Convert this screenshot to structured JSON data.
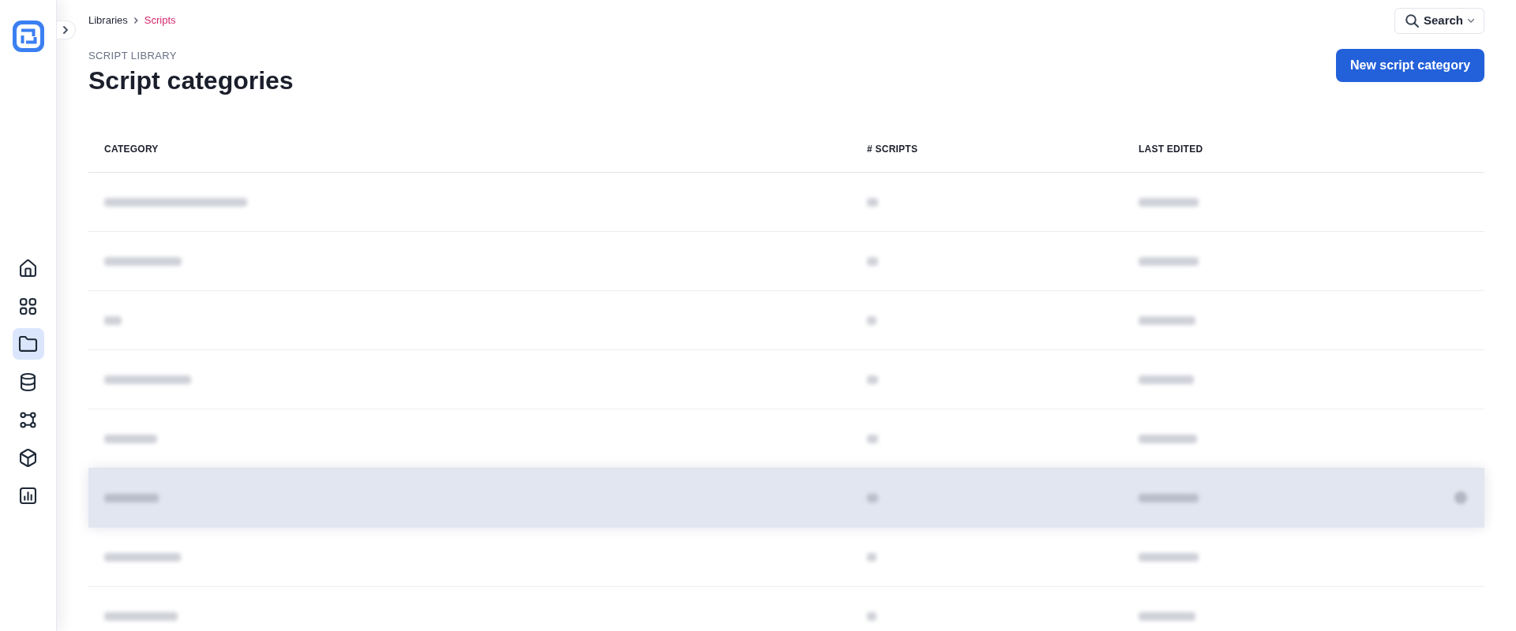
{
  "sidebar": {
    "items": [
      {
        "kind": "home",
        "selected": false
      },
      {
        "kind": "grid",
        "selected": false
      },
      {
        "kind": "folder",
        "selected": true
      },
      {
        "kind": "database",
        "selected": false
      },
      {
        "kind": "nodes",
        "selected": false
      },
      {
        "kind": "cube",
        "selected": false
      },
      {
        "kind": "chart",
        "selected": false
      }
    ]
  },
  "breadcrumbs": [
    {
      "label": "Libraries",
      "current": false
    },
    {
      "label": "Scripts",
      "current": true
    }
  ],
  "header": {
    "eyebrow": "SCRIPT LIBRARY",
    "title": "Script categories"
  },
  "search": {
    "label": "Search"
  },
  "primary_button": {
    "label": "New script category"
  },
  "table": {
    "columns": [
      "CATEGORY",
      "# SCRIPTS",
      "LAST EDITED"
    ],
    "rows": [
      {
        "hovered": false
      },
      {
        "hovered": false
      },
      {
        "hovered": false
      },
      {
        "hovered": false
      },
      {
        "hovered": false
      },
      {
        "hovered": true
      },
      {
        "hovered": false
      },
      {
        "hovered": false
      }
    ]
  }
}
